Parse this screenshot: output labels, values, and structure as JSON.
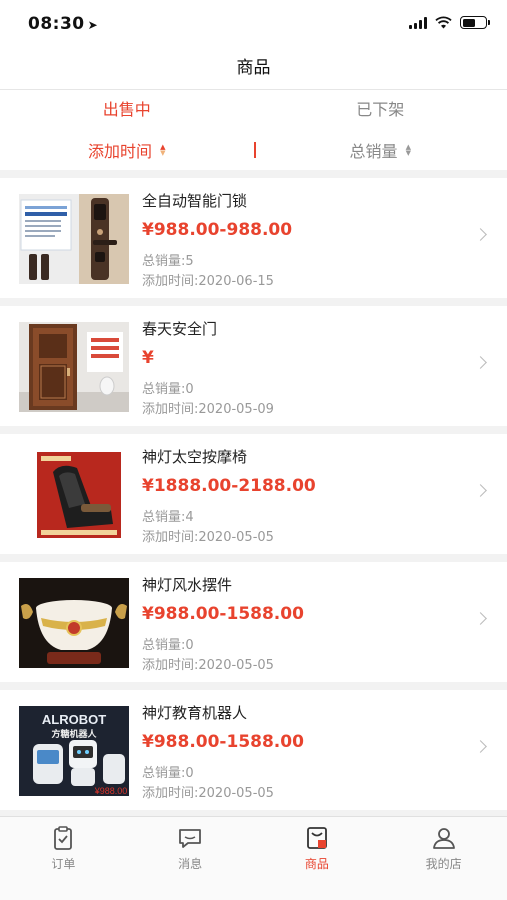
{
  "status_bar": {
    "time": "08:30"
  },
  "nav": {
    "title": "商品"
  },
  "tabs": [
    {
      "label": "出售中",
      "active": true
    },
    {
      "label": "已下架",
      "active": false
    }
  ],
  "sort": [
    {
      "label": "添加时间",
      "active": true
    },
    {
      "label": "总销量",
      "active": false
    }
  ],
  "products": [
    {
      "name": "全自动智能门锁",
      "price": "¥988.00-988.00",
      "sales": "总销量:5",
      "date": "添加时间:2020-06-15",
      "thumb_lines": [
        "智能指纹锁",
        "全自动门锁"
      ],
      "watermark": ""
    },
    {
      "name": "春天安全门",
      "price": "¥",
      "sales": "总销量:0",
      "date": "添加时间:2020-05-09",
      "thumb_lines": [
        "精选钢材",
        "多重防盗"
      ],
      "watermark": ""
    },
    {
      "name": "神灯太空按摩椅",
      "price": "¥1888.00-2188.00",
      "sales": "总销量:4",
      "date": "添加时间:2020-05-05",
      "thumb_lines": [
        "太空按摩椅"
      ],
      "watermark": ""
    },
    {
      "name": "神灯风水摆件",
      "price": "¥988.00-1588.00",
      "sales": "总销量:0",
      "date": "添加时间:2020-05-05",
      "thumb_lines": [],
      "watermark": ""
    },
    {
      "name": "神灯教育机器人",
      "price": "¥988.00-1588.00",
      "sales": "总销量:0",
      "date": "添加时间:2020-05-05",
      "thumb_lines": [
        "ALROBOT",
        "方糖机器人"
      ],
      "watermark": "¥988.00"
    }
  ],
  "tab_bar": [
    {
      "label": "订单",
      "icon": "clipboard-icon",
      "active": false
    },
    {
      "label": "消息",
      "icon": "chat-bubble-icon",
      "active": false
    },
    {
      "label": "商品",
      "icon": "shop-bag-icon",
      "active": true
    },
    {
      "label": "我的店",
      "icon": "person-icon",
      "active": false
    }
  ],
  "colors": {
    "accent": "#e8432e",
    "text": "#222222",
    "muted": "#999999",
    "background": "#f2f2f2"
  }
}
